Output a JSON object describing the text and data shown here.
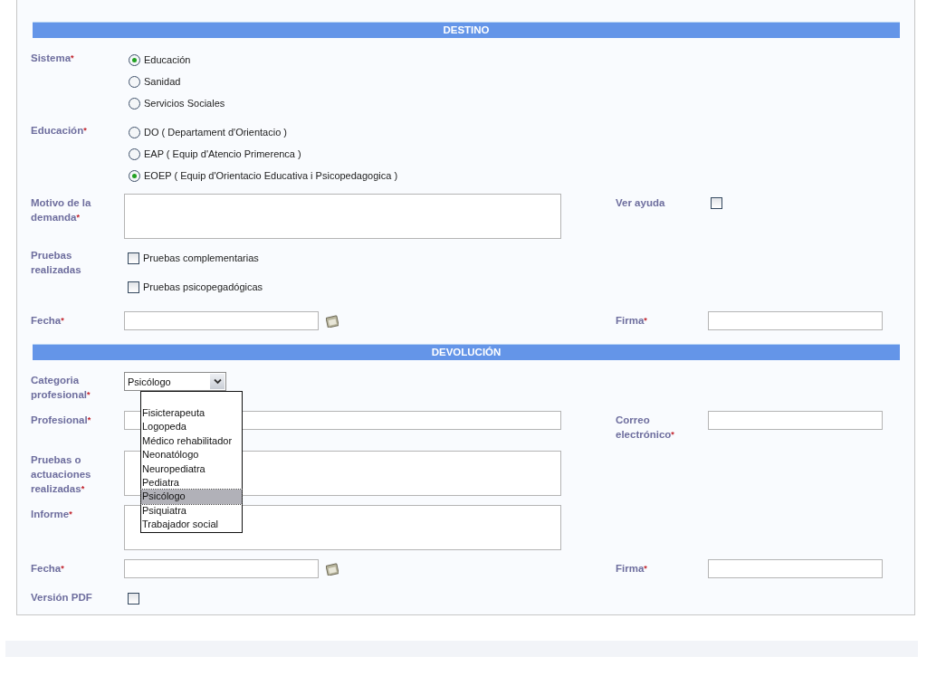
{
  "sections": [
    {
      "title": "DESTINO",
      "rows": [
        {
          "kind": "radio",
          "label": "Sistema",
          "required_mark": "*",
          "options": [
            {
              "label": "Educación",
              "selected": true
            },
            {
              "label": "Sanidad",
              "selected": false
            },
            {
              "label": "Servicios Sociales",
              "selected": false
            }
          ]
        },
        {
          "kind": "radio",
          "label": "Educación",
          "required_mark": "*",
          "options": [
            {
              "label": "DO ( Departament d'Orientacio )",
              "selected": false
            },
            {
              "label": "EAP ( Equip d'Atencio Primerenca )",
              "selected": false
            },
            {
              "label": "EOEP ( Equip d'Orientacio Educativa i Psicopedagogica )",
              "selected": true
            }
          ]
        },
        {
          "kind": "textarea",
          "label": "Motivo de la demanda",
          "required_mark": "*",
          "side": {
            "kind": "checkbox",
            "label": "Ver ayuda",
            "checked": false
          }
        },
        {
          "kind": "checkboxes",
          "label": "Pruebas realizadas",
          "options": [
            {
              "label": "Pruebas complementarias",
              "checked": false
            },
            {
              "label": "Pruebas psicopegadógicas",
              "checked": false
            }
          ]
        },
        {
          "kind": "date",
          "label": "Fecha",
          "required_mark": "*",
          "side": {
            "kind": "text",
            "label": "Firma",
            "required_mark": "*"
          }
        }
      ]
    },
    {
      "title": "DEVOLUCIÓN",
      "rows": [
        {
          "kind": "select",
          "label": "Categoria profesional",
          "required_mark": "*",
          "value": "Psicólogo",
          "expanded": true,
          "options": [
            {
              "label": "Fisicterapeuta",
              "selected": false
            },
            {
              "label": "Logopeda",
              "selected": false
            },
            {
              "label": "Médico rehabilitador",
              "selected": false
            },
            {
              "label": "Neonatólogo",
              "selected": false
            },
            {
              "label": "Neuropediatra",
              "selected": false
            },
            {
              "label": "Pediatra",
              "selected": false
            },
            {
              "label": "Psicólogo",
              "selected": true
            },
            {
              "label": "Psiquiatra",
              "selected": false
            },
            {
              "label": "Trabajador social",
              "selected": false
            }
          ]
        },
        {
          "kind": "text",
          "label": "Profesional",
          "required_mark": "*",
          "side": {
            "kind": "text",
            "label": "Correo electrónico",
            "required_mark": "*"
          }
        },
        {
          "kind": "textarea",
          "label": "Pruebas o actuaciones realizadas",
          "required_mark": "*"
        },
        {
          "kind": "textarea",
          "label": "Informe",
          "required_mark": "*"
        },
        {
          "kind": "date",
          "label": "Fecha",
          "required_mark": "*",
          "side": {
            "kind": "text",
            "label": "Firma",
            "required_mark": "*"
          }
        },
        {
          "kind": "checkbox",
          "label": "Versión PDF",
          "checked": false
        }
      ]
    }
  ]
}
